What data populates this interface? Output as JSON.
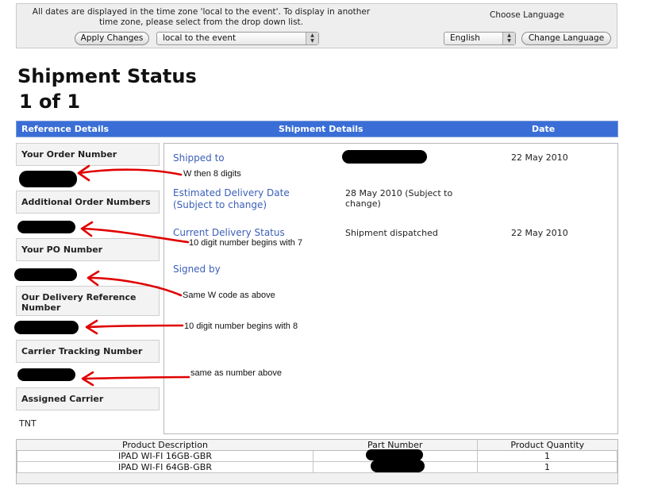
{
  "topbar": {
    "timezone_note": "All dates are displayed in the time zone 'local to the event'. To display in another time zone, please select from the drop down list.",
    "choose_language": "Choose Language",
    "apply_button": "Apply Changes",
    "timezone_value": "local to the event",
    "language_value": "English",
    "change_language_button": "Change Language"
  },
  "page": {
    "title": "Shipment Status",
    "count": "1 of 1"
  },
  "header": {
    "reference": "Reference Details",
    "shipment": "Shipment Details",
    "date": "Date"
  },
  "reference_details": [
    {
      "label": "Your Order Number",
      "value_redacted": true
    },
    {
      "label": "Additional Order Numbers",
      "value_redacted": true
    },
    {
      "label": "Your PO Number",
      "value_redacted": true
    },
    {
      "label": "Our Delivery Reference Number",
      "value_redacted": true
    },
    {
      "label": "Carrier Tracking Number",
      "value_redacted": true
    },
    {
      "label": "Assigned Carrier",
      "value": "TNT"
    }
  ],
  "shipment_details": [
    {
      "label": "Shipped to",
      "value_redacted": true,
      "date": "22 May 2010"
    },
    {
      "label": "Estimated Delivery Date (Subject to change)",
      "value": "28 May 2010 (Subject to change)",
      "date": ""
    },
    {
      "label": "Current Delivery Status",
      "value": "Shipment dispatched",
      "date": "22 May 2010"
    },
    {
      "label": "Signed by",
      "value": "",
      "date": ""
    }
  ],
  "annotations": [
    "W then 8 digits",
    "10 digit number begins  with 7",
    "Same W code as above",
    "10 digit number begins with 8",
    "same as number above"
  ],
  "product_table": {
    "columns": [
      "Product Description",
      "Part Number",
      "Product Quantity"
    ],
    "rows": [
      {
        "description": "IPAD WI-FI 16GB-GBR",
        "part_number_redacted": true,
        "quantity": "1"
      },
      {
        "description": "IPAD WI-FI 64GB-GBR",
        "part_number_redacted": true,
        "quantity": "1"
      }
    ]
  },
  "colors": {
    "header_blue": "#3a6ed6",
    "label_blue": "#3b5fb8",
    "annotation_red": "#e00000"
  }
}
